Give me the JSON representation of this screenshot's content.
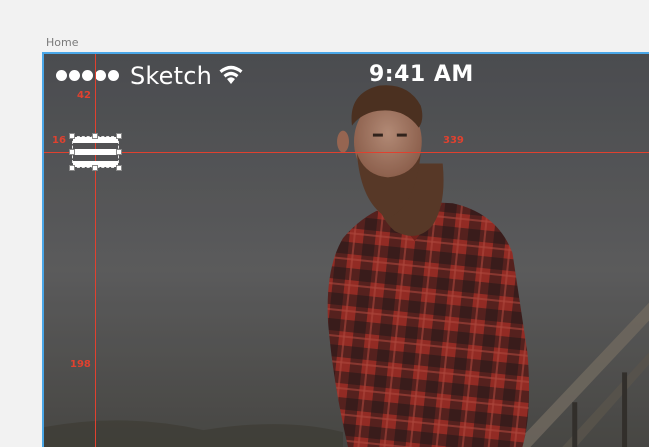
{
  "artboard": {
    "name": "Home",
    "border_color": "#4aa7e8"
  },
  "status_bar": {
    "signal_dots": 5,
    "carrier": "Sketch",
    "wifi_icon": "wifi-icon",
    "time": "9:41 AM"
  },
  "measurements": {
    "top_gap": "42",
    "left_gap": "16",
    "right_gap": "339",
    "bottom_gap": "198",
    "guide_color": "#e0412f"
  },
  "selected_layer": {
    "icon": "hamburger-menu-icon"
  }
}
